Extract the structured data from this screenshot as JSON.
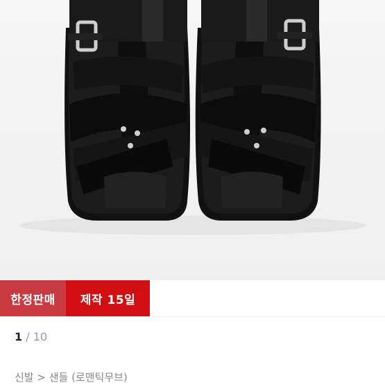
{
  "product_image": {
    "icon": "black-fisherman-sandal-photo"
  },
  "badges": {
    "limited_sale": "한정판매",
    "production_time": "제작 15일"
  },
  "pager": {
    "current": "1",
    "separator": " / ",
    "total": "10"
  },
  "breadcrumb": {
    "text": "신발 > 샌들 (로맨틱무브)"
  },
  "colors": {
    "badge_limited": "#c93a40",
    "badge_production": "#d10e11",
    "background": "#ffffff"
  }
}
